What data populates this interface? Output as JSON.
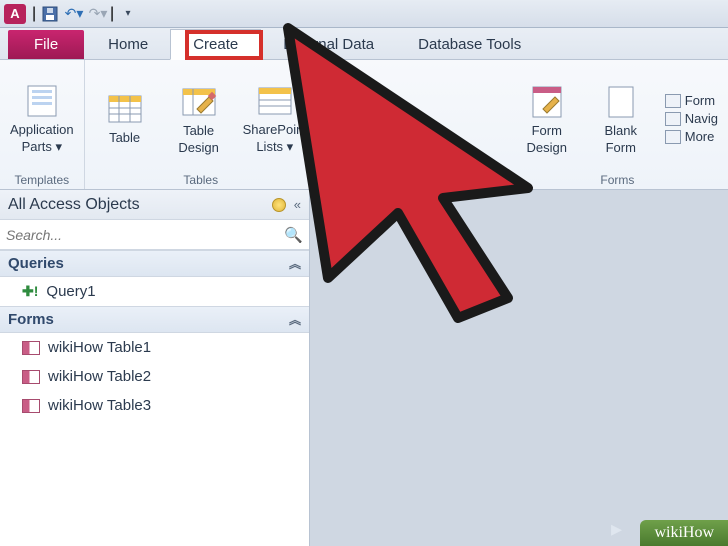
{
  "qat": {
    "app_letter": "A"
  },
  "tabs": {
    "file": "File",
    "items": [
      "Home",
      "Create",
      "External Data",
      "Database Tools"
    ],
    "active_index": 1
  },
  "ribbon": {
    "groups": [
      {
        "label": "Templates",
        "buttons": [
          {
            "label1": "Application",
            "label2": "Parts ▾"
          }
        ]
      },
      {
        "label": "Tables",
        "buttons": [
          {
            "label1": "Table",
            "label2": ""
          },
          {
            "label1": "Table",
            "label2": "Design"
          },
          {
            "label1": "SharePoint",
            "label2": "Lists ▾"
          }
        ]
      },
      {
        "label": "Forms",
        "buttons": [
          {
            "label1": "Form",
            "label2": "Design"
          },
          {
            "label1": "Blank",
            "label2": "Form"
          }
        ],
        "small": [
          "Form",
          "Navig",
          "More"
        ]
      }
    ]
  },
  "nav": {
    "title": "All Access Objects",
    "search_placeholder": "Search...",
    "sections": [
      {
        "title": "Queries",
        "items": [
          {
            "kind": "query",
            "label": "Query1"
          }
        ]
      },
      {
        "title": "Forms",
        "items": [
          {
            "kind": "form",
            "label": "wikiHow Table1"
          },
          {
            "kind": "form",
            "label": "wikiHow Table2"
          },
          {
            "kind": "form",
            "label": "wikiHow Table3"
          }
        ]
      }
    ]
  },
  "watermark": "wikiHow"
}
